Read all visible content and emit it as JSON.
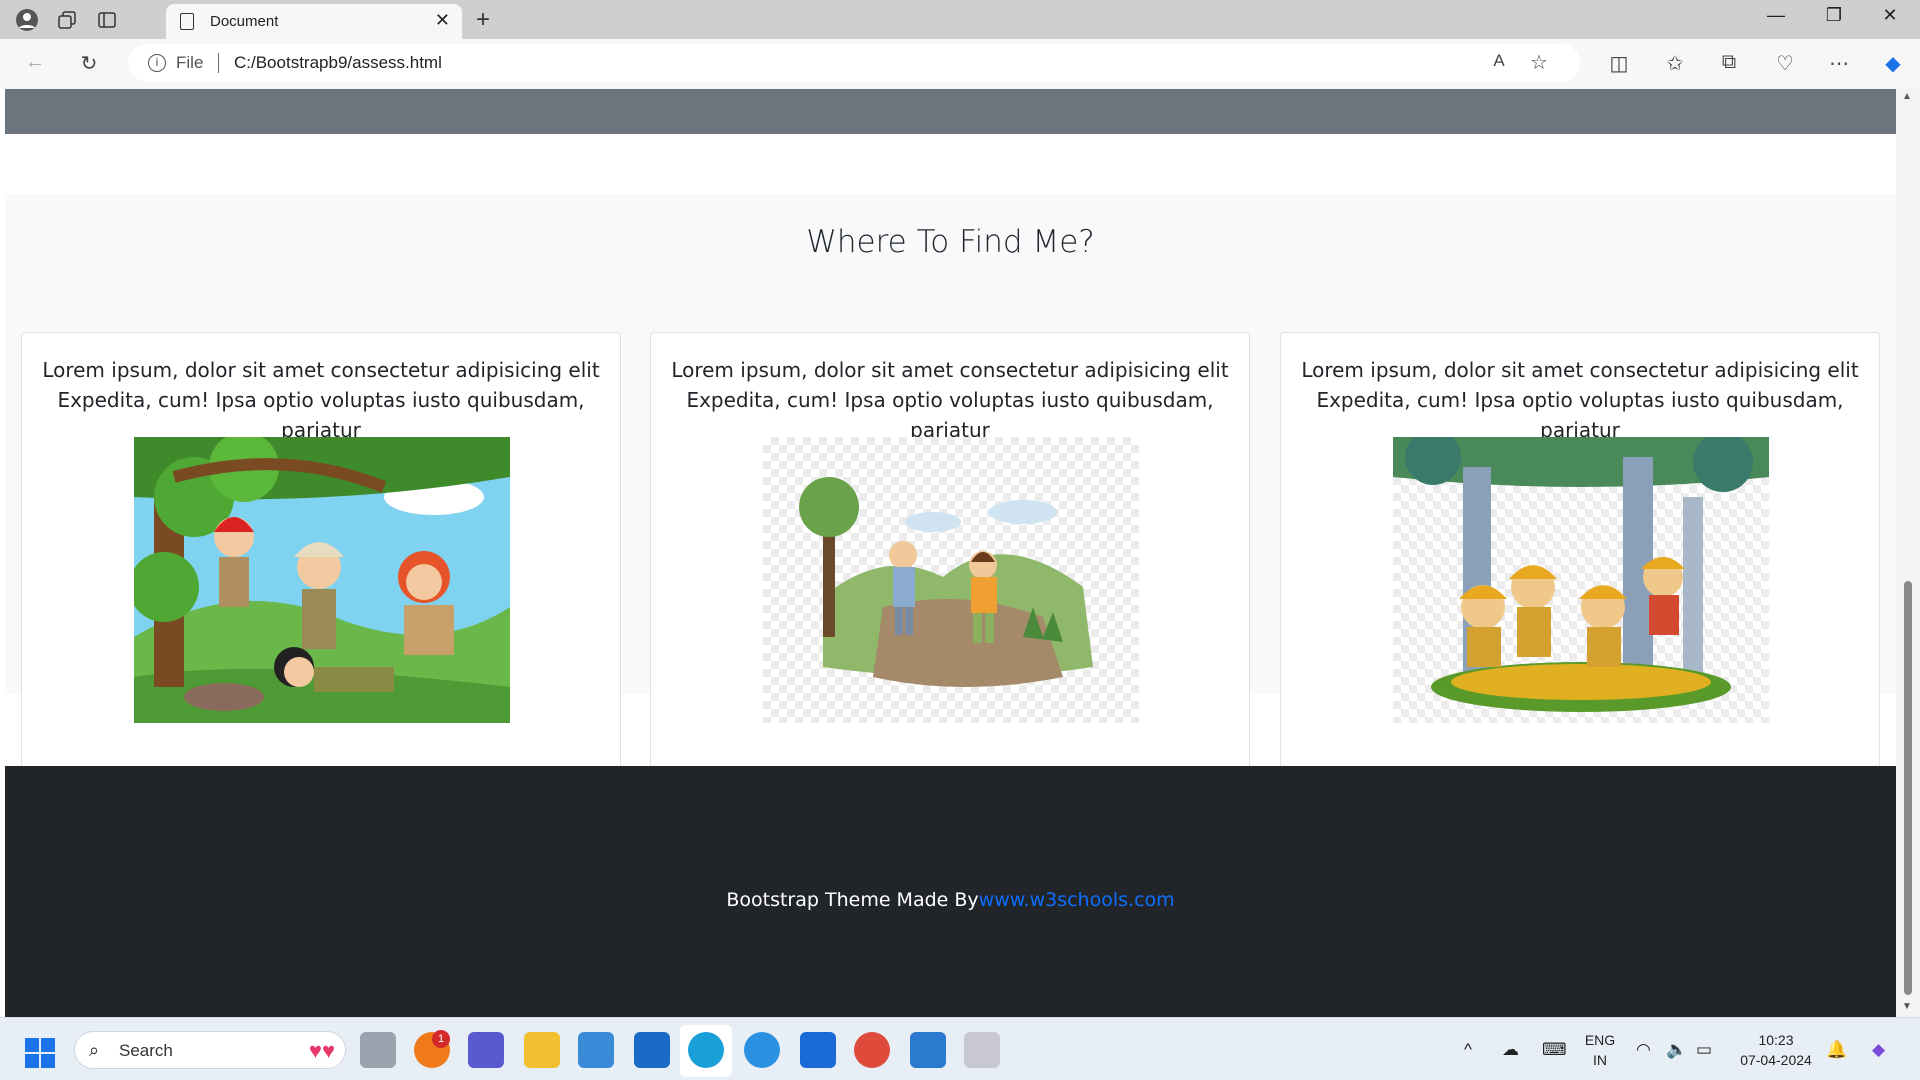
{
  "browser": {
    "tab_title": "Document",
    "address_prefix": "File",
    "url": "C:/Bootstrapb9/assess.html"
  },
  "page": {
    "section_title": "Where To Find Me?",
    "cards": [
      {
        "text": "Lorem ipsum, dolor sit amet consectetur adipisicing elit Expedita, cum! Ipsa optio voluptas iusto quibusdam, pariatur",
        "image_alt": "children-exploring-forest-illustration"
      },
      {
        "text": "Lorem ipsum, dolor sit amet consectetur adipisicing elit Expedita, cum! Ipsa optio voluptas iusto quibusdam, pariatur",
        "image_alt": "kids-hiking-trail-illustration"
      },
      {
        "text": "Lorem ipsum, dolor sit amet consectetur adipisicing elit Expedita, cum! Ipsa optio voluptas iusto quibusdam, pariatur",
        "image_alt": "scout-kids-forest-illustration"
      }
    ],
    "footer_text": "Bootstrap Theme Made By",
    "footer_link": "www.w3schools.com"
  },
  "taskbar": {
    "search_label": "Search",
    "notification_badge": "1",
    "language": "ENG",
    "region": "IN",
    "time": "10:23",
    "date": "07-04-2024"
  },
  "colors": {
    "navbar_gray": "#6c757d",
    "section_bg": "#f8f9fa",
    "footer_bg": "#212529",
    "link_blue": "#0d6efd"
  }
}
